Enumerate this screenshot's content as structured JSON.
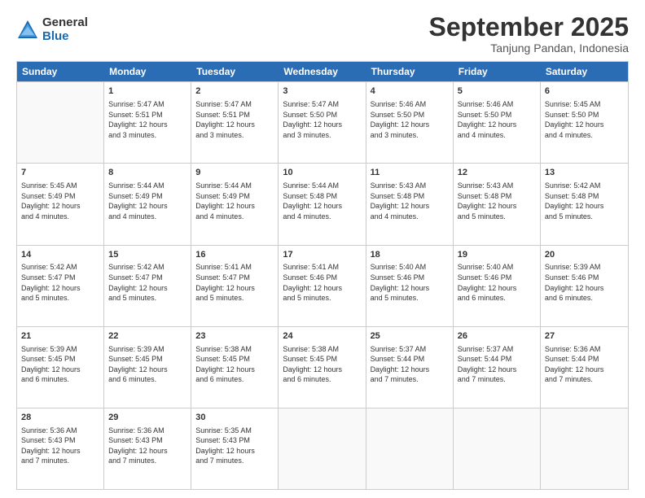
{
  "logo": {
    "general": "General",
    "blue": "Blue"
  },
  "title": "September 2025",
  "subtitle": "Tanjung Pandan, Indonesia",
  "header_days": [
    "Sunday",
    "Monday",
    "Tuesday",
    "Wednesday",
    "Thursday",
    "Friday",
    "Saturday"
  ],
  "weeks": [
    [
      {
        "day": "",
        "info": ""
      },
      {
        "day": "1",
        "info": "Sunrise: 5:47 AM\nSunset: 5:51 PM\nDaylight: 12 hours\nand 3 minutes."
      },
      {
        "day": "2",
        "info": "Sunrise: 5:47 AM\nSunset: 5:51 PM\nDaylight: 12 hours\nand 3 minutes."
      },
      {
        "day": "3",
        "info": "Sunrise: 5:47 AM\nSunset: 5:50 PM\nDaylight: 12 hours\nand 3 minutes."
      },
      {
        "day": "4",
        "info": "Sunrise: 5:46 AM\nSunset: 5:50 PM\nDaylight: 12 hours\nand 3 minutes."
      },
      {
        "day": "5",
        "info": "Sunrise: 5:46 AM\nSunset: 5:50 PM\nDaylight: 12 hours\nand 4 minutes."
      },
      {
        "day": "6",
        "info": "Sunrise: 5:45 AM\nSunset: 5:50 PM\nDaylight: 12 hours\nand 4 minutes."
      }
    ],
    [
      {
        "day": "7",
        "info": "Sunrise: 5:45 AM\nSunset: 5:49 PM\nDaylight: 12 hours\nand 4 minutes."
      },
      {
        "day": "8",
        "info": "Sunrise: 5:44 AM\nSunset: 5:49 PM\nDaylight: 12 hours\nand 4 minutes."
      },
      {
        "day": "9",
        "info": "Sunrise: 5:44 AM\nSunset: 5:49 PM\nDaylight: 12 hours\nand 4 minutes."
      },
      {
        "day": "10",
        "info": "Sunrise: 5:44 AM\nSunset: 5:48 PM\nDaylight: 12 hours\nand 4 minutes."
      },
      {
        "day": "11",
        "info": "Sunrise: 5:43 AM\nSunset: 5:48 PM\nDaylight: 12 hours\nand 4 minutes."
      },
      {
        "day": "12",
        "info": "Sunrise: 5:43 AM\nSunset: 5:48 PM\nDaylight: 12 hours\nand 5 minutes."
      },
      {
        "day": "13",
        "info": "Sunrise: 5:42 AM\nSunset: 5:48 PM\nDaylight: 12 hours\nand 5 minutes."
      }
    ],
    [
      {
        "day": "14",
        "info": "Sunrise: 5:42 AM\nSunset: 5:47 PM\nDaylight: 12 hours\nand 5 minutes."
      },
      {
        "day": "15",
        "info": "Sunrise: 5:42 AM\nSunset: 5:47 PM\nDaylight: 12 hours\nand 5 minutes."
      },
      {
        "day": "16",
        "info": "Sunrise: 5:41 AM\nSunset: 5:47 PM\nDaylight: 12 hours\nand 5 minutes."
      },
      {
        "day": "17",
        "info": "Sunrise: 5:41 AM\nSunset: 5:46 PM\nDaylight: 12 hours\nand 5 minutes."
      },
      {
        "day": "18",
        "info": "Sunrise: 5:40 AM\nSunset: 5:46 PM\nDaylight: 12 hours\nand 5 minutes."
      },
      {
        "day": "19",
        "info": "Sunrise: 5:40 AM\nSunset: 5:46 PM\nDaylight: 12 hours\nand 6 minutes."
      },
      {
        "day": "20",
        "info": "Sunrise: 5:39 AM\nSunset: 5:46 PM\nDaylight: 12 hours\nand 6 minutes."
      }
    ],
    [
      {
        "day": "21",
        "info": "Sunrise: 5:39 AM\nSunset: 5:45 PM\nDaylight: 12 hours\nand 6 minutes."
      },
      {
        "day": "22",
        "info": "Sunrise: 5:39 AM\nSunset: 5:45 PM\nDaylight: 12 hours\nand 6 minutes."
      },
      {
        "day": "23",
        "info": "Sunrise: 5:38 AM\nSunset: 5:45 PM\nDaylight: 12 hours\nand 6 minutes."
      },
      {
        "day": "24",
        "info": "Sunrise: 5:38 AM\nSunset: 5:45 PM\nDaylight: 12 hours\nand 6 minutes."
      },
      {
        "day": "25",
        "info": "Sunrise: 5:37 AM\nSunset: 5:44 PM\nDaylight: 12 hours\nand 7 minutes."
      },
      {
        "day": "26",
        "info": "Sunrise: 5:37 AM\nSunset: 5:44 PM\nDaylight: 12 hours\nand 7 minutes."
      },
      {
        "day": "27",
        "info": "Sunrise: 5:36 AM\nSunset: 5:44 PM\nDaylight: 12 hours\nand 7 minutes."
      }
    ],
    [
      {
        "day": "28",
        "info": "Sunrise: 5:36 AM\nSunset: 5:43 PM\nDaylight: 12 hours\nand 7 minutes."
      },
      {
        "day": "29",
        "info": "Sunrise: 5:36 AM\nSunset: 5:43 PM\nDaylight: 12 hours\nand 7 minutes."
      },
      {
        "day": "30",
        "info": "Sunrise: 5:35 AM\nSunset: 5:43 PM\nDaylight: 12 hours\nand 7 minutes."
      },
      {
        "day": "",
        "info": ""
      },
      {
        "day": "",
        "info": ""
      },
      {
        "day": "",
        "info": ""
      },
      {
        "day": "",
        "info": ""
      }
    ]
  ]
}
